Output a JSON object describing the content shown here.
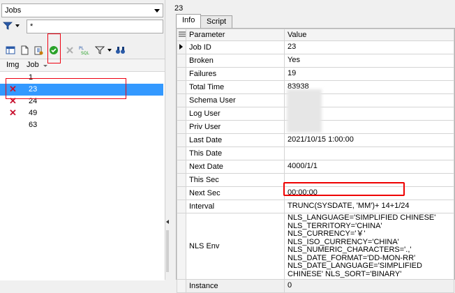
{
  "left": {
    "selector_value": "Jobs",
    "filter_value": "*",
    "columns": {
      "img": "Img",
      "job": "Job"
    },
    "jobs": [
      {
        "id": "1",
        "broken": false,
        "selected": false
      },
      {
        "id": "23",
        "broken": true,
        "selected": true
      },
      {
        "id": "24",
        "broken": true,
        "selected": false
      },
      {
        "id": "49",
        "broken": true,
        "selected": false
      },
      {
        "id": "63",
        "broken": false,
        "selected": false
      }
    ]
  },
  "right": {
    "title": "23",
    "tabs": [
      "Info",
      "Script"
    ],
    "active_tab": "Info",
    "grid_headers": {
      "param": "Parameter",
      "value": "Value"
    },
    "rows": [
      {
        "param": "Job ID",
        "value": "23"
      },
      {
        "param": "Broken",
        "value": "Yes"
      },
      {
        "param": "Failures",
        "value": "19"
      },
      {
        "param": "Total Time",
        "value": "83938"
      },
      {
        "param": "Schema User",
        "value": ""
      },
      {
        "param": "Log User",
        "value": ""
      },
      {
        "param": "Priv User",
        "value": ""
      },
      {
        "param": "Last Date",
        "value": "2021/10/15 1:00:00"
      },
      {
        "param": "This Date",
        "value": ""
      },
      {
        "param": "Next Date",
        "value": "4000/1/1"
      },
      {
        "param": "This Sec",
        "value": ""
      },
      {
        "param": "Next Sec",
        "value": "00:00:00"
      },
      {
        "param": "Interval",
        "value": "TRUNC(SYSDATE, 'MM')+ 14+1/24"
      },
      {
        "param": "NLS Env",
        "value": "NLS_LANGUAGE='SIMPLIFIED CHINESE' NLS_TERRITORY='CHINA' NLS_CURRENCY='￥' NLS_ISO_CURRENCY='CHINA' NLS_NUMERIC_CHARACTERS='.,' NLS_DATE_FORMAT='DD-MON-RR' NLS_DATE_LANGUAGE='SIMPLIFIED CHINESE' NLS_SORT='BINARY'"
      },
      {
        "param": "Instance",
        "value": "0"
      }
    ]
  },
  "colors": {
    "selection": "#3399ff",
    "annotation": "#e00000",
    "broken_icon": "#c8102e"
  }
}
